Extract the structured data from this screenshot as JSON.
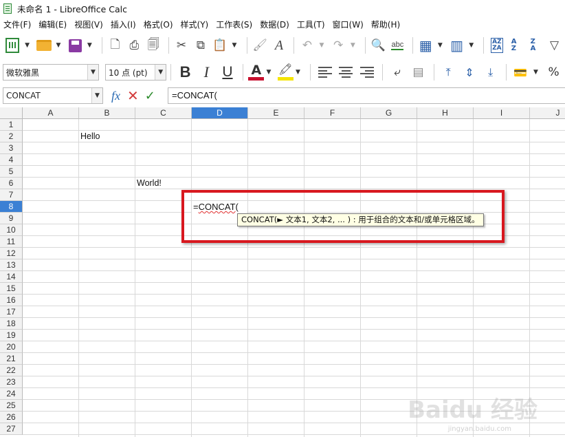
{
  "window": {
    "title": "未命名 1 - LibreOffice Calc"
  },
  "menu": [
    {
      "label": "文件(F)"
    },
    {
      "label": "编辑(E)"
    },
    {
      "label": "视图(V)"
    },
    {
      "label": "插入(I)"
    },
    {
      "label": "格式(O)"
    },
    {
      "label": "样式(Y)"
    },
    {
      "label": "工作表(S)"
    },
    {
      "label": "数据(D)"
    },
    {
      "label": "工具(T)"
    },
    {
      "label": "窗口(W)"
    },
    {
      "label": "帮助(H)"
    }
  ],
  "toolbar": {
    "spellcheck_label": "abc",
    "sort_asc_label": "A Z",
    "sort_desc_label": "Z A"
  },
  "format": {
    "font_name": "微软雅黑",
    "font_size": "10 点 (pt)",
    "bold": "B",
    "italic": "I",
    "underline": "U",
    "font_color_glyph": "A",
    "font_color": "#c8102e",
    "highlight_color": "#f5e400"
  },
  "formula_bar": {
    "name_box": "CONCAT",
    "fx": "fx",
    "cancel": "✕",
    "accept": "✓",
    "content": "=CONCAT("
  },
  "sheet": {
    "columns": [
      "A",
      "B",
      "C",
      "D",
      "E",
      "F",
      "G",
      "H",
      "I",
      "J"
    ],
    "active_column": "D",
    "rows": [
      "1",
      "2",
      "3",
      "4",
      "5",
      "6",
      "7",
      "8",
      "9",
      "10",
      "11",
      "12",
      "13",
      "14",
      "15",
      "16",
      "17",
      "18",
      "19",
      "20",
      "21",
      "22",
      "23",
      "24",
      "25",
      "26",
      "27"
    ],
    "active_row": "8",
    "cells": {
      "B2": "Hello",
      "C6": "World!"
    },
    "edit_cell": {
      "ref": "D8",
      "prefix": "=",
      "func": "CONCAT",
      "suffix": "("
    },
    "tooltip": "CONCAT(► 文本1, 文本2, ...  ) : 用于组合的文本和/或单元格区域。"
  },
  "watermark": {
    "text": "Baidu 经验",
    "sub": "jingyan.baidu.com"
  }
}
